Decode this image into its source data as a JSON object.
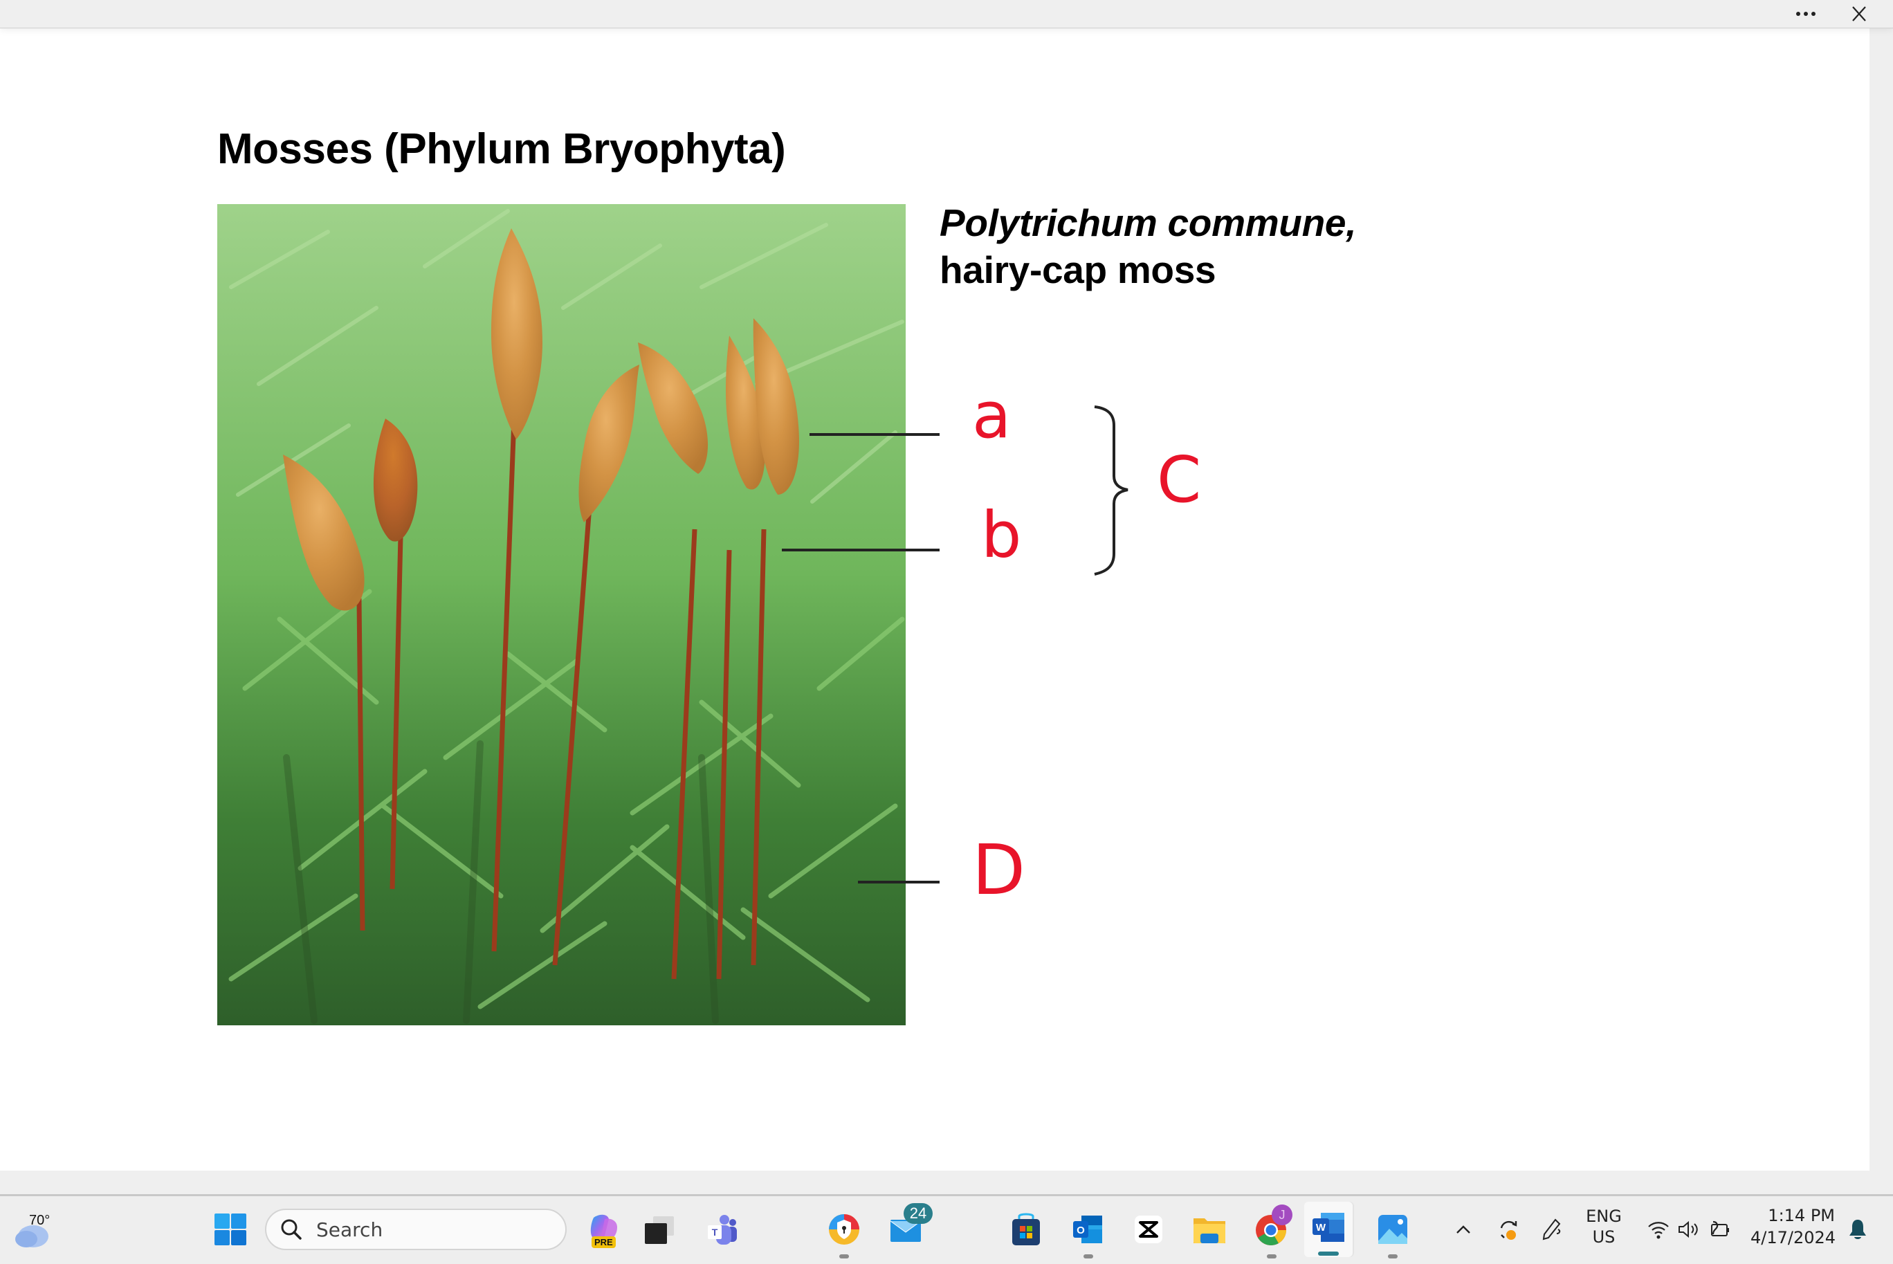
{
  "window": {
    "more_label": "More options",
    "close_label": "Close"
  },
  "slide": {
    "heading": "Mosses (Phylum Bryophyta)",
    "caption_species": "Polytrichum commune,",
    "caption_common": "hairy-cap moss",
    "photo_alt": "Photograph of hairy-cap moss with capsules on reddish stalks above green leafy shoots",
    "annotations": {
      "a": "a",
      "b": "b",
      "c": "C",
      "d": "D",
      "color": "#e8142a"
    }
  },
  "taskbar": {
    "weather": {
      "temp": "70°",
      "icon": "cloudy-icon"
    },
    "search_placeholder": "Search",
    "apps": [
      {
        "name": "Copilot",
        "badge": "PRE",
        "icon": "copilot-icon"
      },
      {
        "name": "Task View",
        "icon": "task-view-icon"
      },
      {
        "name": "Microsoft Teams",
        "icon": "teams-icon"
      },
      {
        "name": "Secure Browser",
        "icon": "secure-browser-icon",
        "running": true
      },
      {
        "name": "Mail",
        "badge": "24",
        "icon": "mail-icon"
      },
      {
        "name": "Microsoft Store",
        "icon": "store-icon"
      },
      {
        "name": "Outlook",
        "icon": "outlook-icon",
        "running": true
      },
      {
        "name": "CapCut",
        "icon": "capcut-icon"
      },
      {
        "name": "File Explorer",
        "icon": "folder-icon"
      },
      {
        "name": "Google Chrome",
        "profile": "J",
        "icon": "chrome-icon",
        "running": true
      },
      {
        "name": "Microsoft Word",
        "icon": "word-icon",
        "active": true
      },
      {
        "name": "Photos",
        "icon": "photos-icon",
        "running": true
      }
    ],
    "tray": {
      "language_line1": "ENG",
      "language_line2": "US",
      "time": "1:14 PM",
      "date": "4/17/2024"
    }
  }
}
